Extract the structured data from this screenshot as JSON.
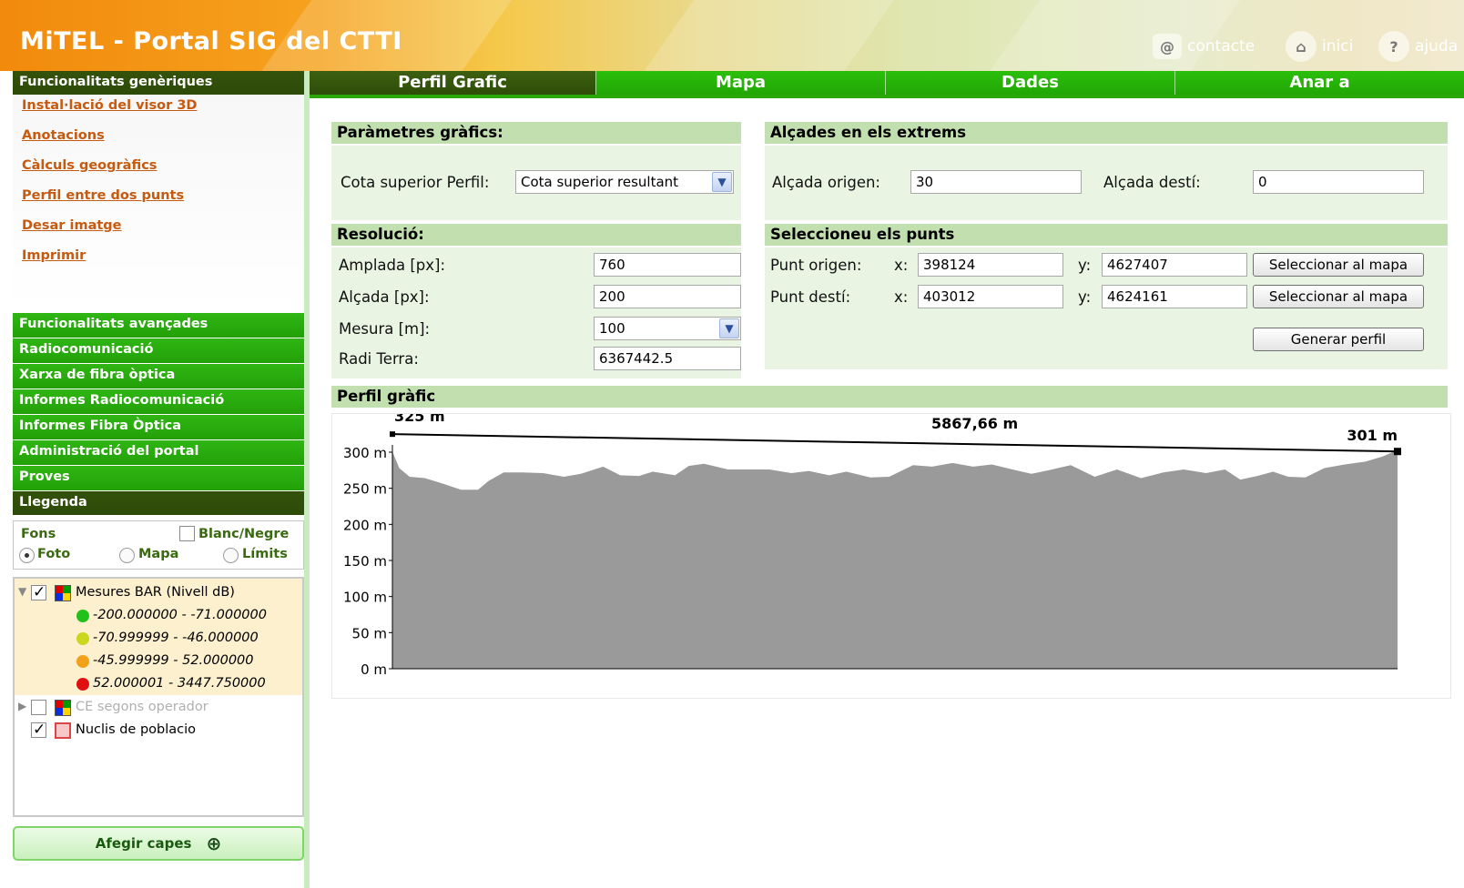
{
  "header": {
    "title": "MiTEL - Portal SIG del CTTI",
    "links": [
      {
        "label": "contacte",
        "icon": "email-icon"
      },
      {
        "label": "inici",
        "icon": "home-icon"
      },
      {
        "label": "ajuda",
        "icon": "help-icon"
      }
    ]
  },
  "sidebar": {
    "generic_header": "Funcionalitats genèriques",
    "generic_items": [
      "Instal·lació del visor 3D",
      "Anotacions",
      "Càlculs geogràfics",
      "Perfil entre dos punts",
      "Desar imatge",
      "Imprimir"
    ],
    "sections": [
      "Funcionalitats avançades",
      "Radiocomunicació",
      "Xarxa de fibra òptica",
      "Informes Radiocomunicació",
      "Informes Fibra Òptica",
      "Administració del portal",
      "Proves"
    ],
    "legend_header": "Llegenda",
    "legend": {
      "fons_label": "Fons",
      "bw_label": "Blanc/Negre",
      "bw_checked": false,
      "radios": [
        {
          "label": "Foto",
          "checked": true
        },
        {
          "label": "Mapa",
          "checked": false
        },
        {
          "label": "Límits",
          "checked": false
        }
      ],
      "layers": [
        {
          "label": "Mesures BAR (Nivell dB)",
          "checked": true,
          "expanded": true,
          "items": [
            {
              "label": "-200.000000 - -71.000000",
              "color": "#22c01a"
            },
            {
              "label": "-70.999999 - -46.000000",
              "color": "#c9d71e"
            },
            {
              "label": "-45.999999 - 52.000000",
              "color": "#f2a11b"
            },
            {
              "label": "52.000001 - 3447.750000",
              "color": "#e01010"
            }
          ]
        },
        {
          "label": "CE segons operador",
          "checked": false,
          "expanded": false
        },
        {
          "label": "Nuclis de poblacio",
          "checked": true
        }
      ]
    },
    "add_layers_label": "Afegir capes"
  },
  "tabs": [
    {
      "label": "Perfil Grafic",
      "active": true
    },
    {
      "label": "Mapa",
      "active": false
    },
    {
      "label": "Dades",
      "active": false
    },
    {
      "label": "Anar a",
      "active": false
    }
  ],
  "graphic_params": {
    "title": "Paràmetres gràfics:",
    "cota_label": "Cota superior Perfil:",
    "cota_value": "Cota superior resultant"
  },
  "resolution": {
    "title": "Resolució:",
    "width_label": "Amplada [px]:",
    "width_value": "760",
    "height_label": "Alçada [px]:",
    "height_value": "200",
    "measure_label": "Mesura [m]:",
    "measure_value": "100",
    "radius_label": "Radi Terra:",
    "radius_value": "6367442.5"
  },
  "heights": {
    "title": "Alçades en els extrems",
    "origin_label": "Alçada origen:",
    "origin_value": "30",
    "dest_label": "Alçada destí:",
    "dest_value": "0"
  },
  "points": {
    "title": "Seleccioneu els punts",
    "origin_label": "Punt origen:",
    "origin_x": "398124",
    "origin_y": "4627407",
    "dest_label": "Punt destí:",
    "dest_x": "403012",
    "dest_y": "4624161",
    "x_label": "x:",
    "y_label": "y:",
    "select_label": "Seleccionar al mapa",
    "generate_label": "Generar perfil"
  },
  "profile": {
    "title": "Perfil gràfic"
  },
  "chart_data": {
    "type": "area",
    "ylim": [
      0,
      300
    ],
    "yticks": [
      "300 m",
      "250 m",
      "200 m",
      "150 m",
      "100 m",
      "50 m",
      "0 m"
    ],
    "ytick_values": [
      300,
      250,
      200,
      150,
      100,
      50,
      0
    ],
    "xlim": [
      0,
      5867.66
    ],
    "terrain": {
      "x": [
        0,
        40,
        100,
        190,
        300,
        400,
        500,
        560,
        650,
        760,
        880,
        1000,
        1100,
        1230,
        1330,
        1440,
        1520,
        1650,
        1730,
        1820,
        1960,
        2080,
        2200,
        2330,
        2430,
        2550,
        2650,
        2790,
        2900,
        3040,
        3150,
        3270,
        3390,
        3500,
        3620,
        3730,
        3830,
        3960,
        4100,
        4230,
        4370,
        4500,
        4620,
        4750,
        4860,
        4950,
        5050,
        5140,
        5230,
        5330,
        5440,
        5560,
        5680,
        5780,
        5867.66
      ],
      "y": [
        301,
        278,
        266,
        264,
        256,
        248,
        248,
        260,
        272,
        272,
        271,
        266,
        270,
        280,
        268,
        267,
        273,
        268,
        281,
        284,
        276,
        276,
        276,
        271,
        274,
        268,
        273,
        265,
        266,
        282,
        280,
        285,
        280,
        283,
        276,
        270,
        275,
        282,
        266,
        276,
        264,
        272,
        276,
        271,
        276,
        262,
        267,
        273,
        266,
        265,
        278,
        283,
        287,
        294,
        303
      ]
    },
    "line_of_sight": {
      "x": [
        0,
        5867.66
      ],
      "y": [
        325,
        301
      ]
    },
    "annotations": [
      {
        "text": "325 m",
        "x": 0,
        "y": 325
      },
      {
        "text": "5867,66 m",
        "x": 2934,
        "y": 325
      },
      {
        "text": "301 m",
        "x": 5867.66,
        "y": 301
      }
    ],
    "colors": {
      "terrain": "#9a9a9a",
      "line": "#000000"
    }
  }
}
